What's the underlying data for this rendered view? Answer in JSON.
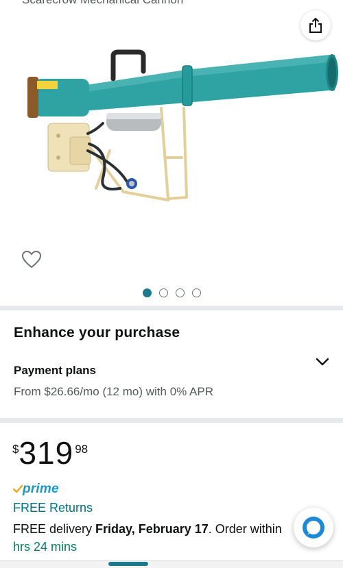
{
  "header": {
    "title_cut": "Scarecrow Mechanical Cannon"
  },
  "gallery": {
    "image_alt": "Propane bird cannon with teal barrel, tan frame, carry handle and gas cylinder",
    "share_icon": "share-icon",
    "favorite_icon": "heart-icon",
    "dots_count": 4,
    "active_dot": 0
  },
  "enhance": {
    "title": "Enhance your purchase",
    "payment_plans_title": "Payment plans",
    "payment_plans_text": "From $26.66/mo (12 mo) with 0% APR",
    "expand_icon": "chevron-down-icon"
  },
  "price": {
    "symbol": "$",
    "whole": "319",
    "fraction": "98"
  },
  "prime": {
    "label": "prime"
  },
  "returns": {
    "label": "FREE Returns"
  },
  "delivery": {
    "prefix": "FREE delivery ",
    "date": "Friday, February 17",
    "suffix": ". Order within",
    "countdown": "hrs 24 mins"
  },
  "colors": {
    "accent": "#1c7a8c",
    "prime_blue": "#1a98c9",
    "link": "#007185",
    "countdown_green": "#067d62",
    "divider": "#e7e9ec"
  }
}
